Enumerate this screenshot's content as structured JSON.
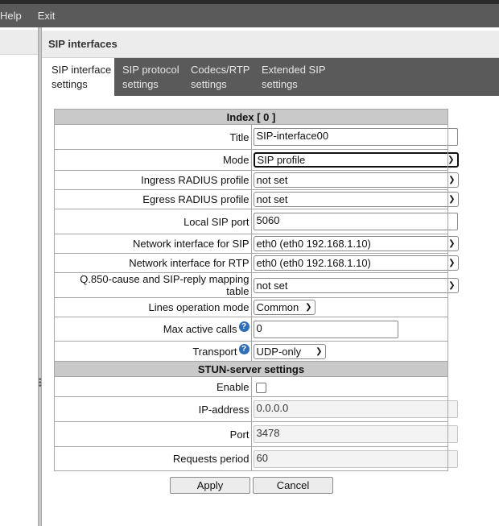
{
  "menubar": {
    "items": [
      "Help",
      "Exit"
    ]
  },
  "panel": {
    "title": "SIP interfaces"
  },
  "tabs": [
    {
      "line1": "SIP interface",
      "line2": "settings",
      "active": true
    },
    {
      "line1": "SIP protocol",
      "line2": "settings",
      "active": false
    },
    {
      "line1": "Codecs/RTP",
      "line2": "settings",
      "active": false
    },
    {
      "line1": "Extended SIP",
      "line2": "settings",
      "active": false
    }
  ],
  "form": {
    "index_header": "Index [ 0 ]",
    "title": {
      "label": "Title",
      "value": "SIP-interface00"
    },
    "mode": {
      "label": "Mode",
      "value": "SIP profile"
    },
    "ingress_radius": {
      "label": "Ingress RADIUS profile",
      "value": "not set"
    },
    "egress_radius": {
      "label": "Egress RADIUS profile",
      "value": "not set"
    },
    "local_sip_port": {
      "label": "Local SIP port",
      "value": "5060"
    },
    "net_if_sip": {
      "label": "Network interface for SIP",
      "value": "eth0 (eth0 192.168.1.10)"
    },
    "net_if_rtp": {
      "label": "Network interface for RTP",
      "value": "eth0 (eth0 192.168.1.10)"
    },
    "q850_mapping": {
      "label": "Q.850-cause and SIP-reply mapping table",
      "value": "not set"
    },
    "lines_mode": {
      "label": "Lines operation mode",
      "value": "Common"
    },
    "max_calls": {
      "label": "Max active calls",
      "value": "0"
    },
    "transport": {
      "label": "Transport",
      "value": "UDP-only"
    },
    "help_glyph": "?"
  },
  "stun": {
    "header": "STUN-server settings",
    "enable": {
      "label": "Enable",
      "checked": false
    },
    "ip": {
      "label": "IP-address",
      "value": "0.0.0.0"
    },
    "port": {
      "label": "Port",
      "value": "3478"
    },
    "period": {
      "label": "Requests period",
      "value": "60"
    }
  },
  "buttons": {
    "apply": "Apply",
    "cancel": "Cancel"
  },
  "icons": {
    "help": "help-icon",
    "dropdown": "chevron-down-icon"
  },
  "colors": {
    "menubar": "#5a5a5a",
    "header_bg": "#c9c9c9",
    "help_icon": "#2f6fb8"
  }
}
